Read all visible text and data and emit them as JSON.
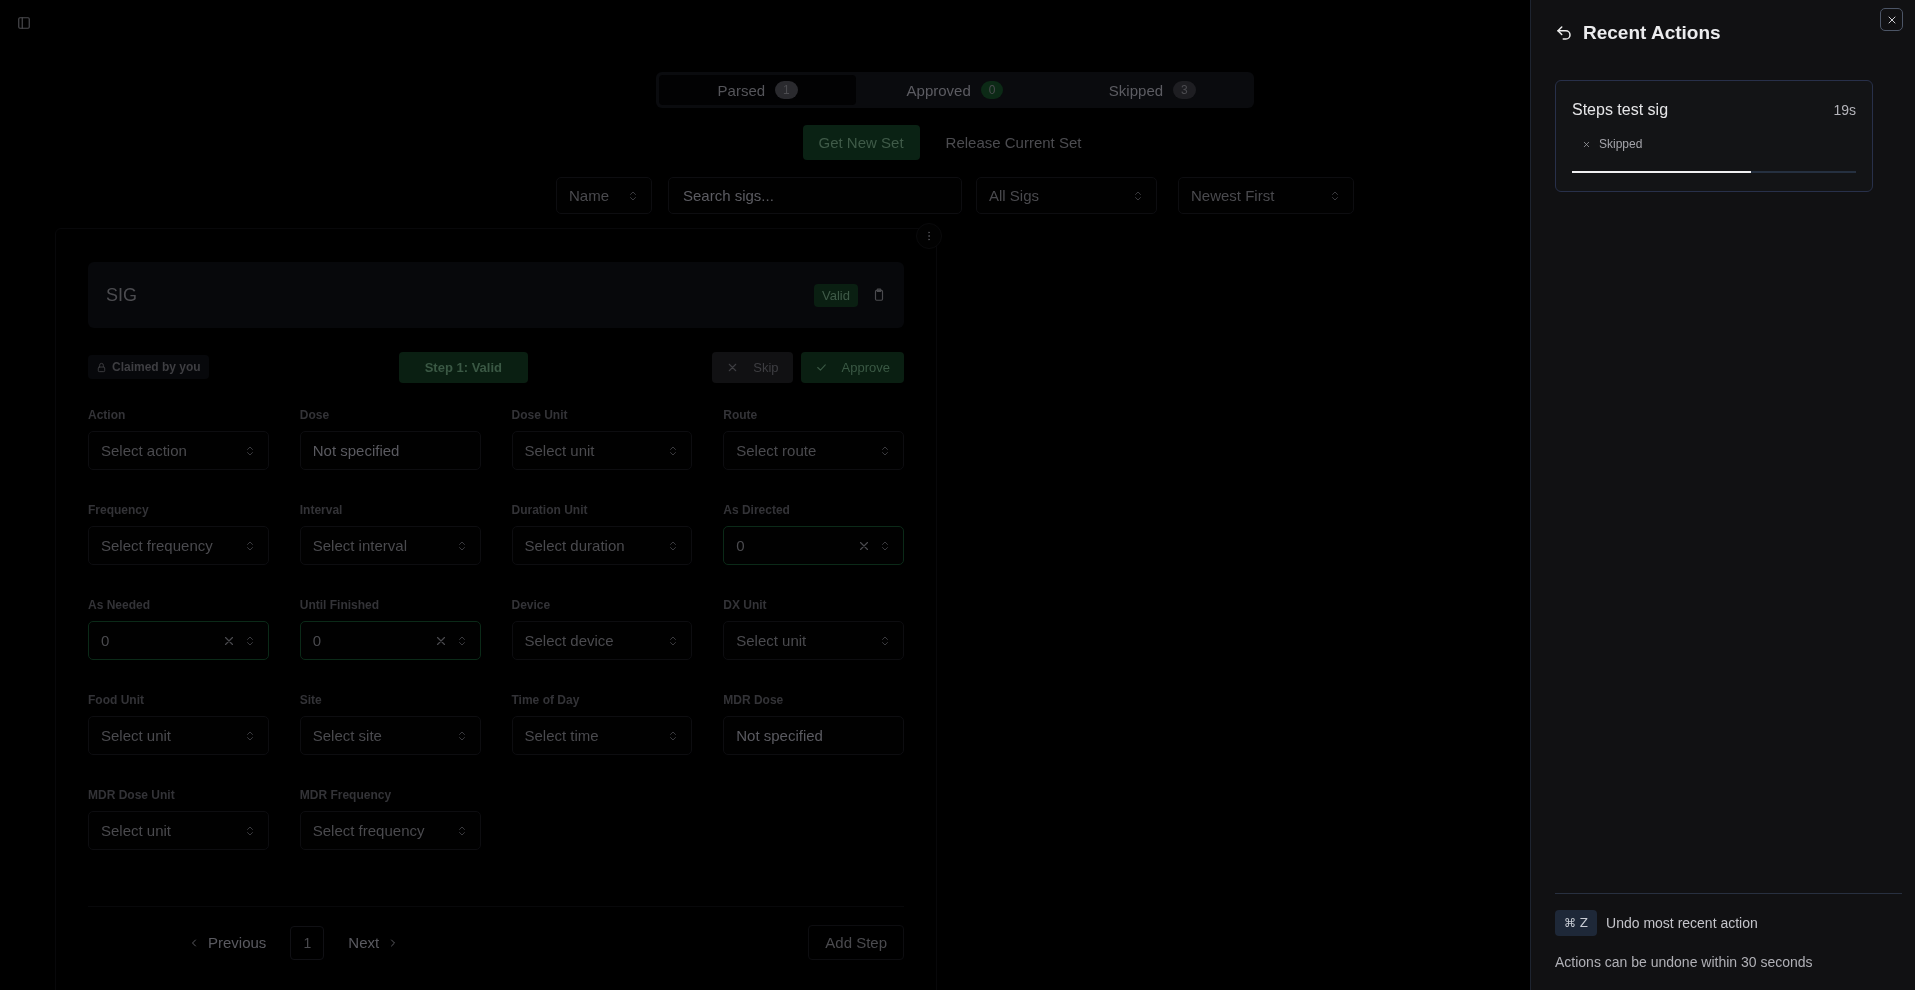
{
  "tabs": [
    {
      "label": "Parsed",
      "count": "1",
      "selected": true,
      "color": "#2a2a2e"
    },
    {
      "label": "Approved",
      "count": "0",
      "selected": false,
      "color": "#0c2a16"
    },
    {
      "label": "Skipped",
      "count": "3",
      "selected": false,
      "color": "#1e1e22"
    }
  ],
  "actions": {
    "primary": "Get New Set",
    "secondary": "Release Current Set"
  },
  "filters": {
    "sort_field": "Name",
    "search": {
      "placeholder": "Search sigs..."
    },
    "scope": "All Sigs",
    "order": "Newest First"
  },
  "sig": {
    "title": "SIG",
    "badge": "Valid",
    "claimed": "Claimed by you",
    "step_status": "Step 1: Valid",
    "skip": "Skip",
    "approve": "Approve"
  },
  "fields": [
    {
      "label": "Action",
      "kind": "select",
      "value": "Select action"
    },
    {
      "label": "Dose",
      "kind": "text",
      "placeholder": "Not specified"
    },
    {
      "label": "Dose Unit",
      "kind": "select",
      "value": "Select unit"
    },
    {
      "label": "Route",
      "kind": "select",
      "value": "Select route"
    },
    {
      "label": "Frequency",
      "kind": "select",
      "value": "Select frequency"
    },
    {
      "label": "Interval",
      "kind": "select",
      "value": "Select interval"
    },
    {
      "label": "Duration Unit",
      "kind": "select",
      "value": "Select duration"
    },
    {
      "label": "As Directed",
      "kind": "clearable",
      "value": "0"
    },
    {
      "label": "As Needed",
      "kind": "clearable",
      "value": "0"
    },
    {
      "label": "Until Finished",
      "kind": "clearable",
      "value": "0"
    },
    {
      "label": "Device",
      "kind": "select",
      "value": "Select device"
    },
    {
      "label": "DX Unit",
      "kind": "select",
      "value": "Select unit"
    },
    {
      "label": "Food Unit",
      "kind": "select",
      "value": "Select unit"
    },
    {
      "label": "Site",
      "kind": "select",
      "value": "Select site"
    },
    {
      "label": "Time of Day",
      "kind": "select",
      "value": "Select time"
    },
    {
      "label": "MDR Dose",
      "kind": "text",
      "placeholder": "Not specified"
    },
    {
      "label": "MDR Dose Unit",
      "kind": "select",
      "value": "Select unit"
    },
    {
      "label": "MDR Frequency",
      "kind": "select",
      "value": "Select frequency"
    }
  ],
  "pagination": {
    "previous": "Previous",
    "pages": [
      {
        "label": "1",
        "selected": true
      }
    ],
    "next": "Next",
    "add": "Add Step"
  },
  "panel": {
    "title": "Recent Actions",
    "items": [
      {
        "name": "Steps test sig",
        "time": "19s",
        "status": "Skipped",
        "level": 0.63
      }
    ],
    "shortcut": {
      "keys": "⌘ Z",
      "text": "Undo most recent action"
    },
    "note": "Actions can be undone within 30 seconds"
  }
}
